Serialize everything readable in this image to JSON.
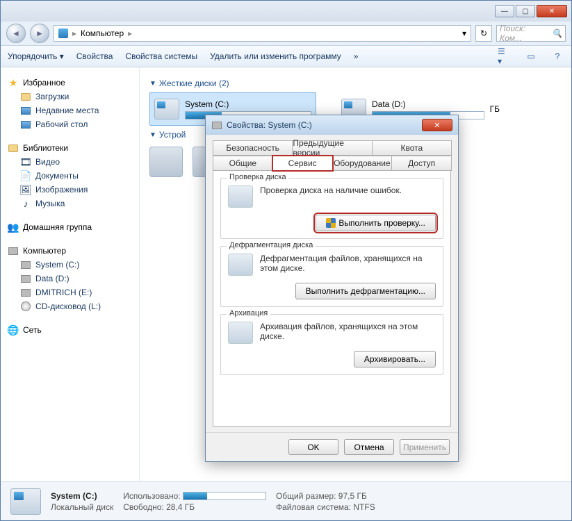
{
  "titlebar": {
    "min": "—",
    "max": "▢",
    "close": "✕"
  },
  "nav": {
    "back": "◄",
    "forward": "►",
    "location": "Компьютер",
    "sep": "▸",
    "dropdown": "▾",
    "refresh": "↻",
    "search_placeholder": "Поиск: Ком..."
  },
  "toolbar": {
    "organize": "Упорядочить ▾",
    "properties": "Свойства",
    "system_properties": "Свойства системы",
    "uninstall": "Удалить или изменить программу",
    "more": "»"
  },
  "sidebar": {
    "favorites": {
      "label": "Избранное",
      "items": [
        "Загрузки",
        "Недавние места",
        "Рабочий стол"
      ]
    },
    "libraries": {
      "label": "Библиотеки",
      "items": [
        "Видео",
        "Документы",
        "Изображения",
        "Музыка"
      ]
    },
    "homegroup": "Домашняя группа",
    "computer": {
      "label": "Компьютер",
      "items": [
        "System (C:)",
        "Data (D:)",
        "DMITRICH (E:)",
        "CD-дисковод (L:)"
      ]
    },
    "network": "Сеть"
  },
  "content": {
    "hdd_section": "Жесткие диски (2)",
    "dev_section": "Устрой",
    "drives": [
      {
        "name": "System (C:)",
        "fill_pct": 29,
        "selected": true
      },
      {
        "name": "Data (D:)",
        "fill_pct": 70,
        "suffix": "ГБ",
        "selected": false
      }
    ]
  },
  "dialog": {
    "title": "Свойства: System (C:)",
    "tabs_row1": [
      "Безопасность",
      "Предыдущие версии",
      "Квота"
    ],
    "tabs_row2": [
      "Общие",
      "Сервис",
      "Оборудование",
      "Доступ"
    ],
    "active_tab": "Сервис",
    "check": {
      "legend": "Проверка диска",
      "text": "Проверка диска на наличие ошибок.",
      "button": "Выполнить проверку..."
    },
    "defrag": {
      "legend": "Дефрагментация диска",
      "text": "Дефрагментация файлов, хранящихся на этом диске.",
      "button": "Выполнить дефрагментацию..."
    },
    "backup": {
      "legend": "Архивация",
      "text": "Архивация файлов, хранящихся на этом диске.",
      "button": "Архивировать..."
    },
    "buttons": {
      "ok": "OK",
      "cancel": "Отмена",
      "apply": "Применить"
    }
  },
  "statusbar": {
    "name": "System (C:)",
    "type": "Локальный диск",
    "used_label": "Использовано:",
    "free_label": "Свободно:",
    "free_value": "28,4 ГБ",
    "total_label": "Общий размер:",
    "total_value": "97,5 ГБ",
    "fs_label": "Файловая система:",
    "fs_value": "NTFS"
  }
}
